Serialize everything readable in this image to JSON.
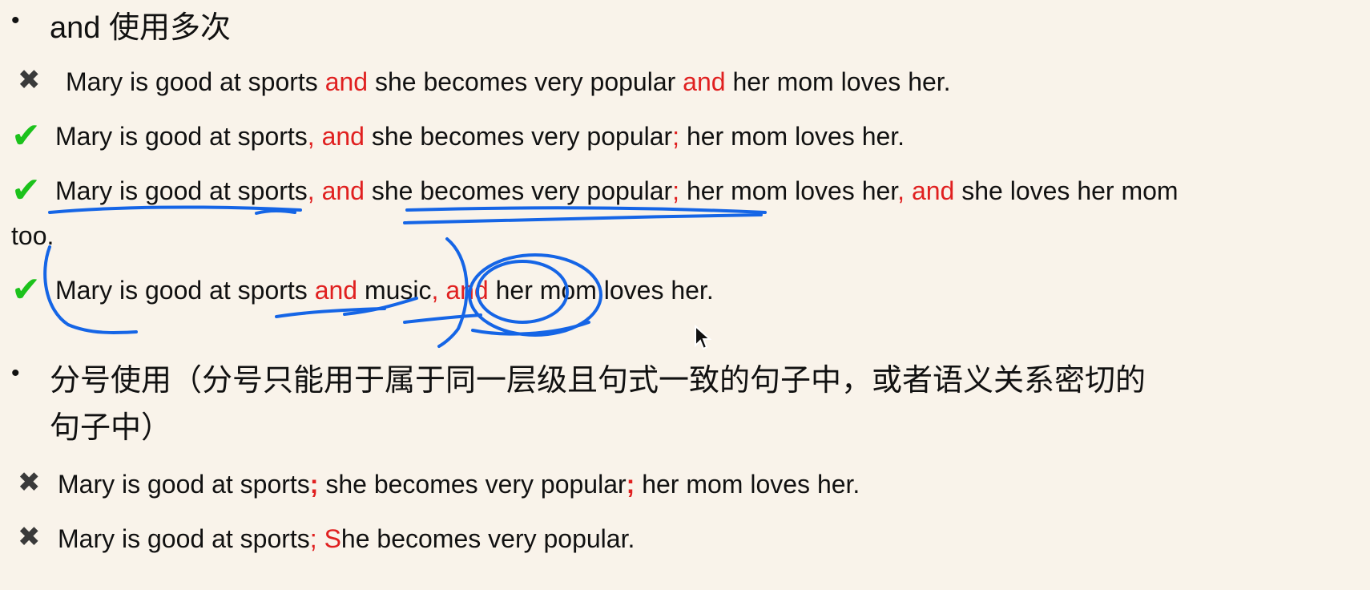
{
  "section1": {
    "bullet": "•",
    "title": "and 使用多次"
  },
  "examples1": [
    {
      "mark": "✖",
      "parts": [
        "Mary is good at sports ",
        "and",
        " she becomes very popular ",
        "and",
        " her mom loves her."
      ]
    },
    {
      "mark": "✔",
      "parts": [
        "Mary is good at sports",
        ", and",
        " she becomes very popular",
        ";",
        " her mom loves her."
      ]
    },
    {
      "mark": "✔",
      "parts": [
        "Mary is good at sports",
        ", and",
        " she becomes very popular",
        ";",
        " her mom loves her",
        ", and",
        " she loves her mom",
        "too."
      ]
    },
    {
      "mark": "✔",
      "parts": [
        "Mary is good at sports ",
        "and",
        " music",
        ", and",
        " her mom loves her."
      ]
    }
  ],
  "section2": {
    "bullet": "•",
    "title_line1": "分号使用（分号只能用于属于同一层级且句式一致的句子中，或者语义关系密切的",
    "title_line2": "句子中）"
  },
  "examples2": [
    {
      "mark": "✖",
      "parts": [
        "Mary is good at sports",
        ";",
        " she becomes very popular",
        ";",
        " her mom loves her."
      ]
    },
    {
      "mark": "✖",
      "parts": [
        "Mary is good at sports",
        "; S",
        "he becomes very popular."
      ]
    }
  ],
  "colors": {
    "background": "#f9f3ea",
    "highlight": "#e02020",
    "check": "#1cc21c",
    "cross": "#3a3a3a",
    "ink": "#1565e6"
  },
  "icons": {
    "cross": "x-mark-icon",
    "check": "check-mark-icon",
    "cursor": "mouse-pointer-icon"
  }
}
